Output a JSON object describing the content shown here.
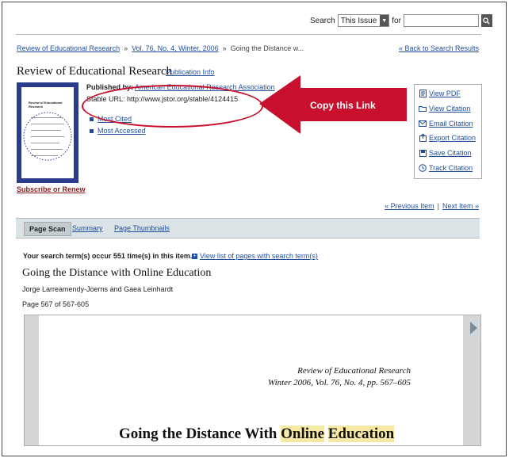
{
  "search": {
    "label": "Search",
    "scope": "This Issue",
    "for_label": "for",
    "query": ""
  },
  "breadcrumb": [
    "Review of Educational Research",
    "Vol. 76, No. 4, Winter, 2006",
    "Going the Distance w..."
  ],
  "back_link": "« Back to Search Results",
  "journal": {
    "title": "Review of Educational Research",
    "pub_info_link": "Publication Info",
    "cover_title": "Review of Educational Research",
    "published_label": "Published by:",
    "publisher": "American Educational Research Association",
    "stable_url_label": "Stable URL:",
    "stable_url": "http://www.jstor.org/stable/4124415",
    "subscribe": "Subscribe or Renew"
  },
  "journal_links": [
    "Most Cited",
    "Most Accessed"
  ],
  "annotation": {
    "label": "Copy this Link",
    "color": "#c8102e"
  },
  "actions": [
    {
      "label": "View PDF",
      "icon": "pdf-icon"
    },
    {
      "label": "View Citation",
      "icon": "folder-icon"
    },
    {
      "label": "Email Citation",
      "icon": "envelope-icon"
    },
    {
      "label": "Export Citation",
      "icon": "export-icon"
    },
    {
      "label": "Save Citation",
      "icon": "save-icon"
    },
    {
      "label": "Track Citation",
      "icon": "clock-icon"
    }
  ],
  "pager": {
    "previous": "« Previous Item",
    "separator": "|",
    "next": "Next Item »"
  },
  "tabs": [
    "Page Scan",
    "Summary",
    "Page Thumbnails"
  ],
  "results": {
    "occurrences": "Your search term(s) occur 551 time(s) in this item.",
    "view_list": "View list of pages with search term(s)"
  },
  "article": {
    "title": "Going the Distance with Online Education",
    "authors": "Jorge Larreamendy-Joerns and Gaea Leinhardt",
    "page_count": "Page 567 of 567-605"
  },
  "scan": {
    "journal": "Review of Educational Research",
    "issue": "Winter 2006, Vol. 76, No. 4, pp. 567–605",
    "title_before": "Going the Distance With ",
    "highlight_1": "Online",
    "space": " ",
    "highlight_2": "Education"
  },
  "colors": {
    "link": "#1f4e9c",
    "highlight": "#f6e9a6",
    "cover": "#2a3b8c"
  }
}
